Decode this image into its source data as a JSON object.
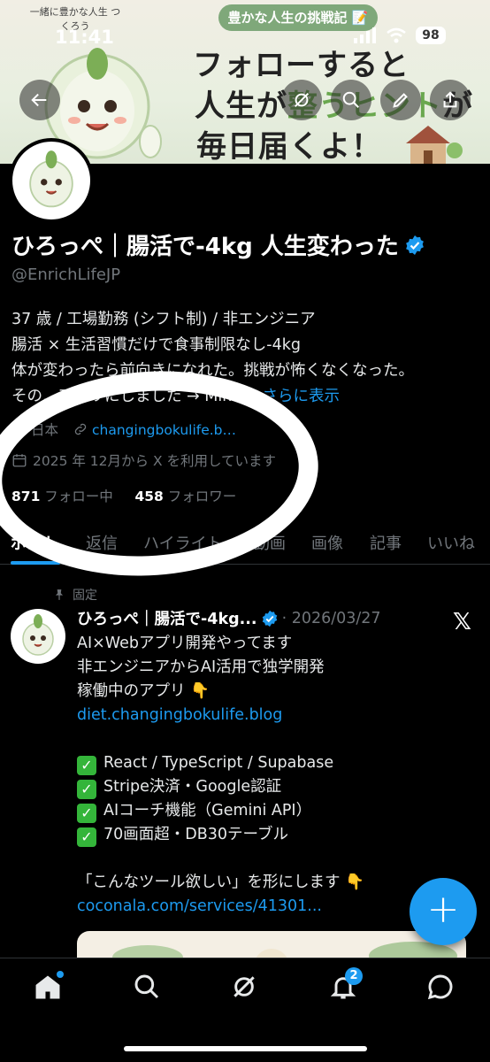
{
  "status_bar": {
    "time": "11:41",
    "battery": "98"
  },
  "banner": {
    "tag": "豊かな人生の挑戦記 📝",
    "circle_text": "一緒に豊かな人生 つくろう",
    "line1": "フォローすると",
    "line2a": "人生が",
    "line2b": "整うヒント",
    "line2c": "が",
    "line3": "毎日届くよ！"
  },
  "profile": {
    "name": "ひろっぺ｜腸活で-4kg 人生変わった",
    "handle": "@EnrichLifeJP",
    "bio": [
      "37 歳 / 工場勤務 (シフト制) / 非エンジニア",
      "腸活 × 生活習慣だけで食事制限なし-4kg",
      "体が変わったら前向きになれた。挑戦が怖くなくなった。",
      "その…アプリにしました → Mind…"
    ],
    "bio_more": "さらに表示",
    "location": "日本",
    "website": "changingbokulife.b…",
    "joined": "2025 年 12月から X を利用しています",
    "following_count": "871",
    "following_label": "フォロー中",
    "followers_count": "458",
    "followers_label": "フォロワー"
  },
  "tabs": [
    "ポスト",
    "返信",
    "ハイライト",
    "動画",
    "画像",
    "記事",
    "いいね"
  ],
  "pinned_post": {
    "pinned_label": "固定",
    "name": "ひろっぺ｜腸活で-4kg...",
    "date": "· 2026/03/27",
    "lines": [
      "AI×Webアプリ開発やってます",
      "非エンジニアからAI活用で独学開発",
      "稼働中のアプリ 👇"
    ],
    "link1": "diet.changingbokulife.blog",
    "checks": [
      "React / TypeScript / Supabase",
      "Stripe決済・Google認証",
      "AIコーチ機能（Gemini API）",
      "70画面超・DB30テーブル"
    ],
    "closing": "「こんなツール欲しい」を形にします 👇",
    "link2": "coconala.com/services/41301..."
  },
  "fab_label": "+",
  "nav": {
    "notifications_badge": "2"
  },
  "colors": {
    "accent": "#1d9bf0",
    "background": "#000000",
    "muted": "#71767b"
  }
}
